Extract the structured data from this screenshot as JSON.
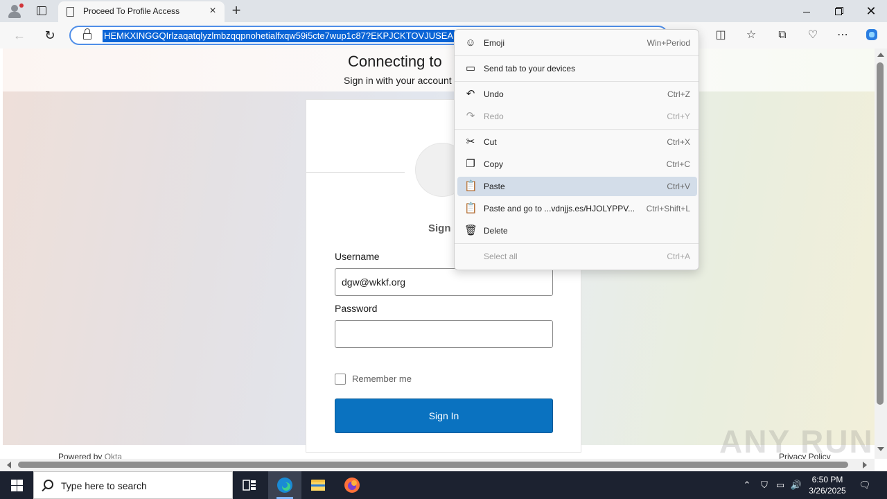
{
  "browser": {
    "tab_title": "Proceed To Profile Access",
    "tab_close_glyph": "×",
    "new_tab_glyph": "+",
    "url": "HEMKXINGGQIrlzaqatqlyzlmbzqqpnohetialfxqw59i5cte7wup1c87?EKPJCKTOVJUSEA",
    "window_controls": {
      "minimize": "minimize-icon",
      "maximize": "maximize-icon",
      "close": "✕"
    },
    "toolbar_icons": [
      "split-screen-icon",
      "favorites-icon",
      "collections-icon",
      "browser-essentials-icon",
      "more-icon",
      "copilot-icon"
    ]
  },
  "page": {
    "header_title": "Connecting to",
    "header_subtitle": "Sign in with your account",
    "sign_in_heading": "Sign I",
    "username_label": "Username",
    "username_value": "dgw@wkkf.org",
    "password_label": "Password",
    "password_value": "",
    "remember_me_label": "Remember me",
    "sign_in_button": "Sign In",
    "powered_by": "Powered by",
    "powered_by_brand": "Okta",
    "privacy_policy": "Privacy Policy",
    "watermark": "ANY RUN"
  },
  "context_menu": {
    "items": [
      {
        "icon": "☺",
        "label": "Emoji",
        "shortcut": "Win+Period",
        "enabled": true
      },
      {
        "icon": "▭",
        "label": "Send tab to your devices",
        "shortcut": "",
        "enabled": true
      },
      {
        "icon": "↶",
        "label": "Undo",
        "shortcut": "Ctrl+Z",
        "enabled": true
      },
      {
        "icon": "↷",
        "label": "Redo",
        "shortcut": "Ctrl+Y",
        "enabled": false
      },
      {
        "icon": "✂",
        "label": "Cut",
        "shortcut": "Ctrl+X",
        "enabled": true
      },
      {
        "icon": "❐",
        "label": "Copy",
        "shortcut": "Ctrl+C",
        "enabled": true
      },
      {
        "icon": "📋",
        "label": "Paste",
        "shortcut": "Ctrl+V",
        "enabled": true,
        "highlighted": true
      },
      {
        "icon": "📋",
        "label": "Paste and go to ...vdnjjs.es/HJOLYPPV...",
        "shortcut": "Ctrl+Shift+L",
        "enabled": true
      },
      {
        "icon": "🗑",
        "label": "Delete",
        "shortcut": "",
        "enabled": true
      },
      {
        "icon": "",
        "label": "Select all",
        "shortcut": "Ctrl+A",
        "enabled": false
      }
    ]
  },
  "taskbar": {
    "search_placeholder": "Type here to search",
    "time": "6:50 PM",
    "date": "3/26/2025",
    "apps": [
      "task-view-icon",
      "edge-icon",
      "file-explorer-icon",
      "firefox-icon"
    ]
  },
  "colors": {
    "accent": "#0a72c0",
    "url_highlight": "#0a64d6",
    "menu_highlight": "#d3dde9",
    "taskbar": "#1c2230"
  }
}
